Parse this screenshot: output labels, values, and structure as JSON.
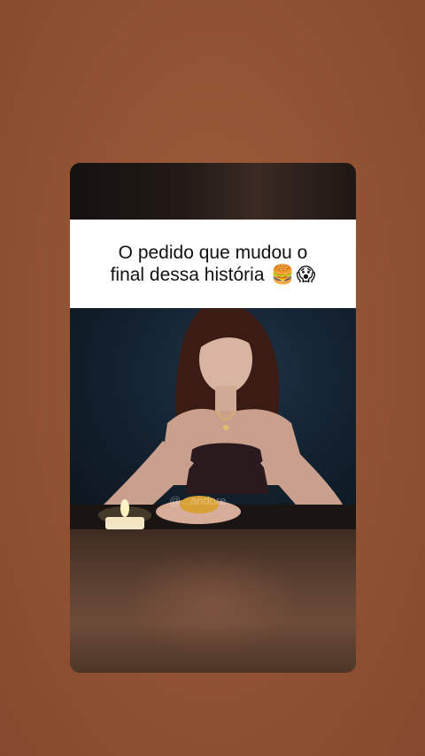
{
  "post": {
    "caption_line1": "O pedido que mudou o",
    "caption_line2": "final dessa história",
    "emoji_1": "🍔",
    "emoji_2": "😱",
    "watermark": "@...andore"
  },
  "colors": {
    "background": "#925434",
    "caption_bg": "#ffffff",
    "caption_text": "#111111"
  }
}
